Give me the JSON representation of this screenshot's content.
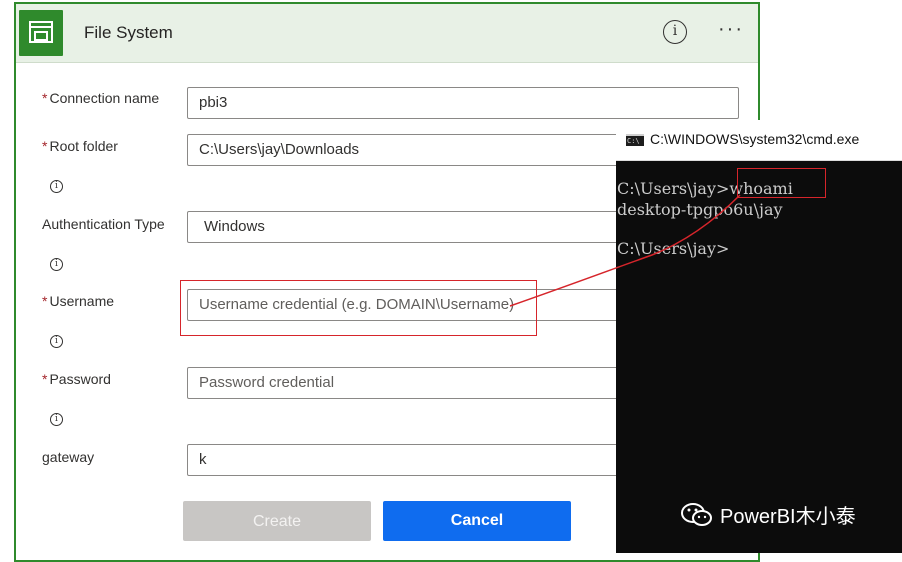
{
  "dialog": {
    "title": "File System",
    "info_icon": "ⓘ",
    "more_icon": "···",
    "accent_color": "#2f8a2c"
  },
  "form": {
    "connection_name": {
      "label": "Connection name",
      "required": "*",
      "value": "pbi3"
    },
    "root_folder": {
      "label": "Root folder",
      "required": "*",
      "value": "C:\\Users\\jay\\Downloads"
    },
    "authentication_type": {
      "label": "Authentication Type",
      "value": "Windows"
    },
    "username": {
      "label": "Username",
      "required": "*",
      "placeholder": "Username credential (e.g. DOMAIN\\Username)"
    },
    "password": {
      "label": "Password",
      "required": "*",
      "placeholder": "Password credential"
    },
    "gateway": {
      "label": "gateway",
      "value": "k"
    },
    "info_glyph": "i"
  },
  "buttons": {
    "create": "Create",
    "cancel": "Cancel"
  },
  "cmd": {
    "title": "C:\\WINDOWS\\system32\\cmd.exe",
    "icon_text": "C:\\",
    "lines": [
      "C:\\Users\\jay>whoami",
      "desktop-tpgpo6u\\jay",
      "",
      "C:\\Users\\jay>"
    ]
  },
  "watermark": "PowerBI木小泰",
  "annotation_color": "#d6252b"
}
